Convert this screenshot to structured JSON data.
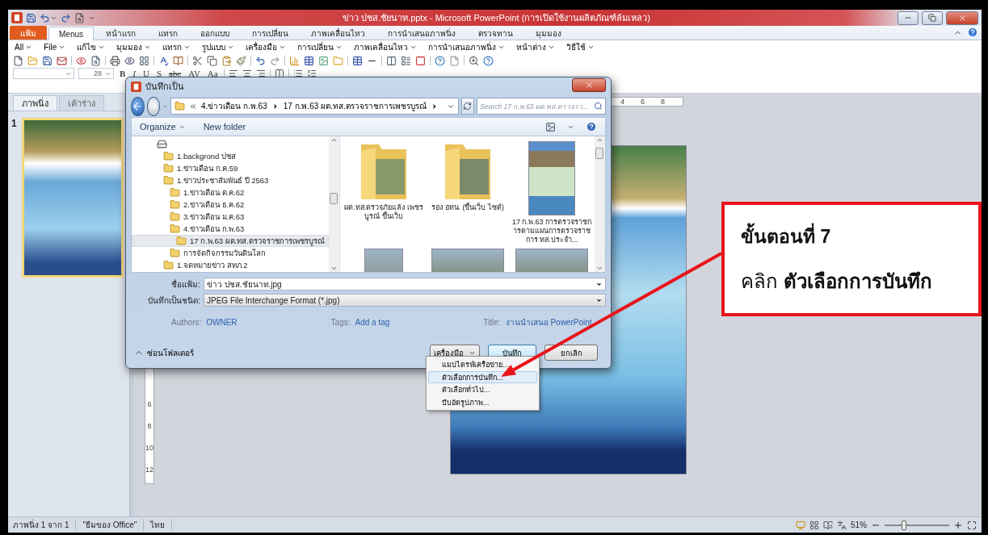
{
  "window": {
    "title": "ข่าว ปชส.ชัยนาท.pptx - Microsoft PowerPoint (การเปิดใช้งานผลิตภัณฑ์ล้มเหลว)"
  },
  "ribbon_tabs": [
    {
      "label": "แฟ้ม",
      "kind": "file",
      "selected": false
    },
    {
      "label": "Menus",
      "kind": "tab",
      "selected": true
    },
    {
      "label": "หน้าแรก",
      "kind": "tab",
      "selected": false
    },
    {
      "label": "แทรก",
      "kind": "tab",
      "selected": false
    },
    {
      "label": "ออกแบบ",
      "kind": "tab",
      "selected": false
    },
    {
      "label": "การเปลี่ยน",
      "kind": "tab",
      "selected": false
    },
    {
      "label": "ภาพเคลื่อนไหว",
      "kind": "tab",
      "selected": false
    },
    {
      "label": "การนำเสนอภาพนิ่ง",
      "kind": "tab",
      "selected": false
    },
    {
      "label": "ตรวจทาน",
      "kind": "tab",
      "selected": false
    },
    {
      "label": "มุมมอง",
      "kind": "tab",
      "selected": false
    }
  ],
  "menus": [
    "All",
    "File",
    "แก้ไข",
    "มุมมอง",
    "แทรก",
    "รูปแบบ",
    "เครื่องมือ",
    "การเปลี่ยน",
    "ภาพเคลื่อนไหว",
    "การนำเสนอภาพนิ่ง",
    "หน้าต่าง",
    "วิธีใช้"
  ],
  "format_bar": {
    "font_size": "28",
    "buttons": [
      "B",
      "I",
      "U",
      "S",
      "abc",
      "AV",
      "Aa"
    ]
  },
  "slide_panel": {
    "tabs": [
      {
        "label": "ภาพนิ่ง",
        "selected": true
      },
      {
        "label": "เค้าร่าง",
        "selected": false
      }
    ],
    "slide_number": "1"
  },
  "rulers": {
    "horizontal": [
      "4",
      "6",
      "8"
    ],
    "vertical": [
      "6",
      "8",
      "10",
      "12"
    ]
  },
  "dialog": {
    "title": "บันทึกเป็น",
    "breadcrumb": [
      "4.ข่าวเดือน ก.พ.63",
      "17 ก.พ.63 ผต.ทส.ตรวจราชการเพชรบูรณ์"
    ],
    "search": {
      "placeholder": "Search 17 ก.พ.63 ผต.ทส.ตรวจรา..."
    },
    "commands": [
      "Organize",
      "New folder"
    ],
    "tree": {
      "kind": "drive",
      "children": [
        {
          "label": "1.backgrond ปชส",
          "selected": false
        },
        {
          "label": "1.ข่าวเดือน ก.ค.59",
          "selected": false
        },
        {
          "label": "1.ข่าวประชาสัมพันธ์ ปี 2563",
          "selected": false,
          "children": [
            {
              "label": "1.ข่าวเดือน ต.ค.62",
              "selected": false
            },
            {
              "label": "2.ข่าวเดือน ธ.ค.62",
              "selected": false
            },
            {
              "label": "3.ข่าวเดือน ม.ค.63",
              "selected": false
            },
            {
              "label": "4.ข่าวเดือน ก.พ.63",
              "selected": false,
              "children": [
                {
                  "label": "17 ก.พ.63 ผต.ทส.ตรวจราชการเพชรบูรณ์",
                  "selected": true
                }
              ]
            },
            {
              "label": "การจัดกิจกรรมวันดินโลก",
              "selected": false
            }
          ]
        },
        {
          "label": "1.จดหมายข่าว สทภ.2",
          "selected": false
        }
      ]
    },
    "files": [
      {
        "kind": "folder",
        "name": "ผต.ทส.ตรวจภัยแล้ง เพชรบูรณ์ ขึ้นเว็บ"
      },
      {
        "kind": "folder",
        "name": "รอง อทน. (ขึ้นเว็บ ไซต์)"
      },
      {
        "kind": "image",
        "name": "17 ก.พ.63 การตรวจราชการตามแผนการตรวจราชการ ทส.ประจำ..."
      },
      {
        "kind": "image"
      },
      {
        "kind": "image"
      },
      {
        "kind": "image"
      }
    ],
    "filename": {
      "label": "ชื่อแฟ้ม:",
      "value": "ข่าว ปชส.ชัยนาท.jpg"
    },
    "filetype": {
      "label": "บันทึกเป็นชนิด:",
      "value": "JPEG File Interchange Format (*.jpg)"
    },
    "meta": [
      {
        "label": "Authors:",
        "value": "OWNER"
      },
      {
        "label": "Tags:",
        "value": "Add a tag"
      },
      {
        "label": "Title:",
        "value": "งานนำเสนอ PowerPoint"
      }
    ],
    "hide_folders": "ซ่อนโฟลเดอร์",
    "tools": "เครื่องมือ",
    "save": "บันทึก",
    "cancel": "ยกเลิก",
    "tools_menu": [
      {
        "label": "แมปไดรฟ์เครือข่าย...",
        "selected": false
      },
      {
        "label": "ตัวเลือกการบันทึก...",
        "selected": true
      },
      {
        "label": "ตัวเลือกทั่วไป...",
        "selected": false
      },
      {
        "label": "บีบอัดรูปภาพ...",
        "selected": false
      }
    ]
  },
  "callout": {
    "heading": "ขั้นตอนที่ 7",
    "text": "คลิก **ตัวเลือกการบันทึก**"
  },
  "status_bar": {
    "items": [
      "ภาพนิ่ง 1 จาก 1",
      "\"ธีมของ Office\"",
      "ไทย"
    ],
    "zoom": "51%",
    "zoom_slider": {
      "level": 0.3
    }
  }
}
